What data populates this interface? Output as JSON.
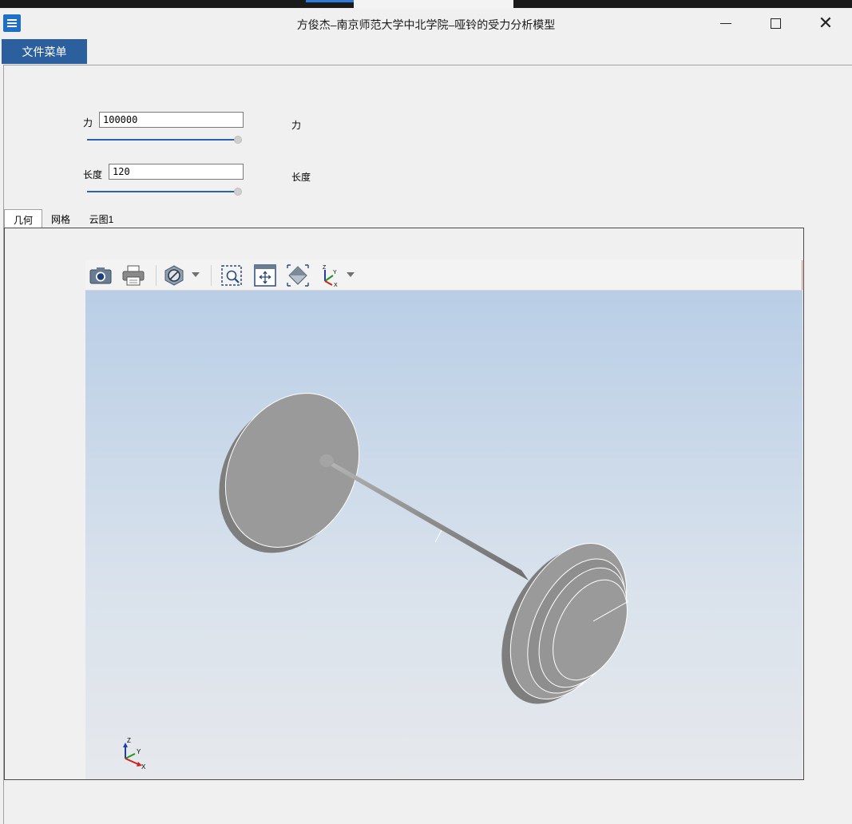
{
  "window": {
    "title": "方俊杰–南京师范大学中北学院–哑铃的受力分析模型",
    "icon": "app-icon",
    "controls": [
      "minimize-icon",
      "maximize-icon",
      "close-icon"
    ]
  },
  "menu": {
    "file_label": "文件菜单"
  },
  "params": {
    "force": {
      "label": "力",
      "value": "100000",
      "side_label": "力",
      "slider_level": 1.0
    },
    "length": {
      "label": "长度",
      "value": "120",
      "side_label": "长度",
      "slider_level": 1.0
    }
  },
  "tabs": [
    {
      "label": "几何",
      "active": true
    },
    {
      "label": "网格",
      "active": false
    },
    {
      "label": "云图1",
      "active": false
    }
  ],
  "toolbar": {
    "icons": [
      "camera-icon",
      "print-icon",
      "clip-plane-icon",
      "zoom-box-icon",
      "fit-view-icon",
      "iso-view-icon",
      "axes-orientation-icon"
    ]
  },
  "axes": {
    "z": "Z",
    "y": "Y",
    "x": "X"
  },
  "colors": {
    "accent": "#2c5f9e",
    "slider": "#2a62b0",
    "model": "#9a9a9a",
    "bg_top": "#b9cee6",
    "bg_bottom": "#e6e8ec"
  }
}
